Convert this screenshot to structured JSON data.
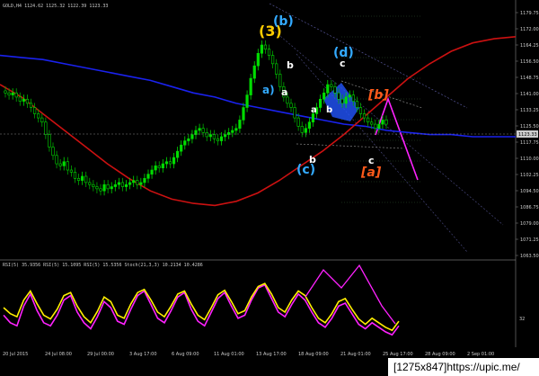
{
  "symbol_header": "GOLD,H4  1124.62 1125.32 1122.39 1123.33",
  "oscillator_header": "RSI(5) 35.9356  RSI(5) 15.1095  RSI(5) 15.5356  Stoch(21,3,3) 10.2134 10.4286",
  "footer_text": "[1275x847]https://upic.me/",
  "price_label": "1123.33",
  "wave_labels": {
    "w3": "(3)",
    "wb": "(b)",
    "wa": "a)",
    "wa2": "a",
    "wb2": "b",
    "wd": "(d)",
    "wc": "c",
    "wcb": "b",
    "wcc": "(c)",
    "wbb": "[b]",
    "wcbottom": "c",
    "waa": "[a]",
    "small_a": "a",
    "small_b": "b"
  },
  "colors": {
    "bull": "#00dd00",
    "bear": "#00aa00",
    "ma_blue": "#1a22ee",
    "ma_red": "#cc1111",
    "wave_yellow": "#ffcc00",
    "wave_cyan": "#33aaff",
    "wave_orange": "#ff5a1a",
    "magenta": "#ff22ff",
    "rsi_yellow": "#ffee00"
  },
  "chart_data": {
    "type": "candlestick",
    "symbol": "GOLD",
    "timeframe": "H4",
    "ohlc_header": [
      1124.62,
      1125.32,
      1122.39,
      1123.33
    ],
    "current_price": 1123.33,
    "y_tick_labels": [
      "1179.75",
      "1172.00",
      "1164.25",
      "1156.50",
      "1148.75",
      "1141.00",
      "1133.25",
      "1125.50",
      "1117.75",
      "1110.00",
      "1102.25",
      "1094.50",
      "1086.75",
      "1079.00",
      "1071.25",
      "1063.50"
    ],
    "x_tick_labels": [
      "20 Jul 2015",
      "24 Jul 08:00",
      "29 Jul 00:00",
      "3 Aug 17:00",
      "6 Aug 09:00",
      "11 Aug 01:00",
      "13 Aug 17:00",
      "18 Aug 09:00",
      "21 Aug 01:00",
      "25 Aug 17:00",
      "28 Aug 09:00",
      "2 Sep 01:00"
    ],
    "ylim": [
      1060,
      1180
    ],
    "series_close": [
      1138,
      1137,
      1138,
      1136,
      1134,
      1135,
      1133,
      1131,
      1128,
      1126,
      1124,
      1118,
      1112,
      1108,
      1104,
      1103,
      1105,
      1101,
      1100,
      1097,
      1096,
      1098,
      1095,
      1094,
      1093,
      1092,
      1091,
      1094,
      1092,
      1093,
      1094,
      1095,
      1093,
      1094,
      1095,
      1096,
      1094,
      1095,
      1097,
      1099,
      1101,
      1103,
      1102,
      1104,
      1105,
      1104,
      1107,
      1110,
      1113,
      1115,
      1116,
      1118,
      1120,
      1121,
      1119,
      1117,
      1118,
      1116,
      1115,
      1117,
      1118,
      1119,
      1120,
      1121,
      1125,
      1131,
      1137,
      1145,
      1151,
      1157,
      1161,
      1159,
      1156,
      1152,
      1147,
      1141,
      1136,
      1133,
      1131,
      1126,
      1122,
      1119,
      1121,
      1124,
      1128,
      1131,
      1135,
      1138,
      1142,
      1141,
      1138,
      1135,
      1133,
      1136,
      1137,
      1134,
      1131,
      1128,
      1126,
      1124,
      1123,
      1121,
      1123,
      1125,
      1123
    ],
    "ma_blue": [
      1156,
      1155,
      1154,
      1152,
      1150,
      1148,
      1146,
      1144,
      1141,
      1138,
      1136,
      1133,
      1131,
      1129,
      1127,
      1125,
      1123,
      1122,
      1120,
      1119,
      1118,
      1118,
      1117,
      1117,
      1117
    ],
    "ma_red": [
      1142,
      1136,
      1128,
      1120,
      1112,
      1104,
      1097,
      1091,
      1087,
      1085,
      1084,
      1086,
      1090,
      1096,
      1103,
      1110,
      1118,
      1127,
      1136,
      1145,
      1152,
      1158,
      1162,
      1164,
      1165
    ],
    "oscillator": {
      "rsi": [
        50,
        42,
        38,
        60,
        72,
        55,
        40,
        35,
        48,
        66,
        70,
        52,
        38,
        30,
        45,
        64,
        58,
        40,
        36,
        55,
        70,
        74,
        60,
        44,
        38,
        52,
        68,
        72,
        55,
        40,
        34,
        50,
        67,
        73,
        58,
        42,
        46,
        64,
        78,
        82,
        68,
        50,
        44,
        60,
        72,
        66,
        50,
        36,
        30,
        42,
        58,
        62,
        48,
        35,
        28,
        36,
        30,
        24,
        20,
        32
      ],
      "stoch": [
        40,
        30,
        26,
        52,
        68,
        46,
        30,
        26,
        40,
        60,
        66,
        44,
        30,
        22,
        38,
        58,
        50,
        32,
        28,
        48,
        66,
        72,
        54,
        36,
        30,
        46,
        64,
        70,
        48,
        32,
        26,
        44,
        62,
        70,
        52,
        36,
        40,
        60,
        76,
        80,
        62,
        44,
        38,
        54,
        68,
        60,
        44,
        30,
        24,
        36,
        52,
        56,
        42,
        28,
        22,
        30,
        24,
        18,
        14,
        26
      ],
      "ylim": [
        0,
        100
      ],
      "right_label": "32"
    }
  }
}
